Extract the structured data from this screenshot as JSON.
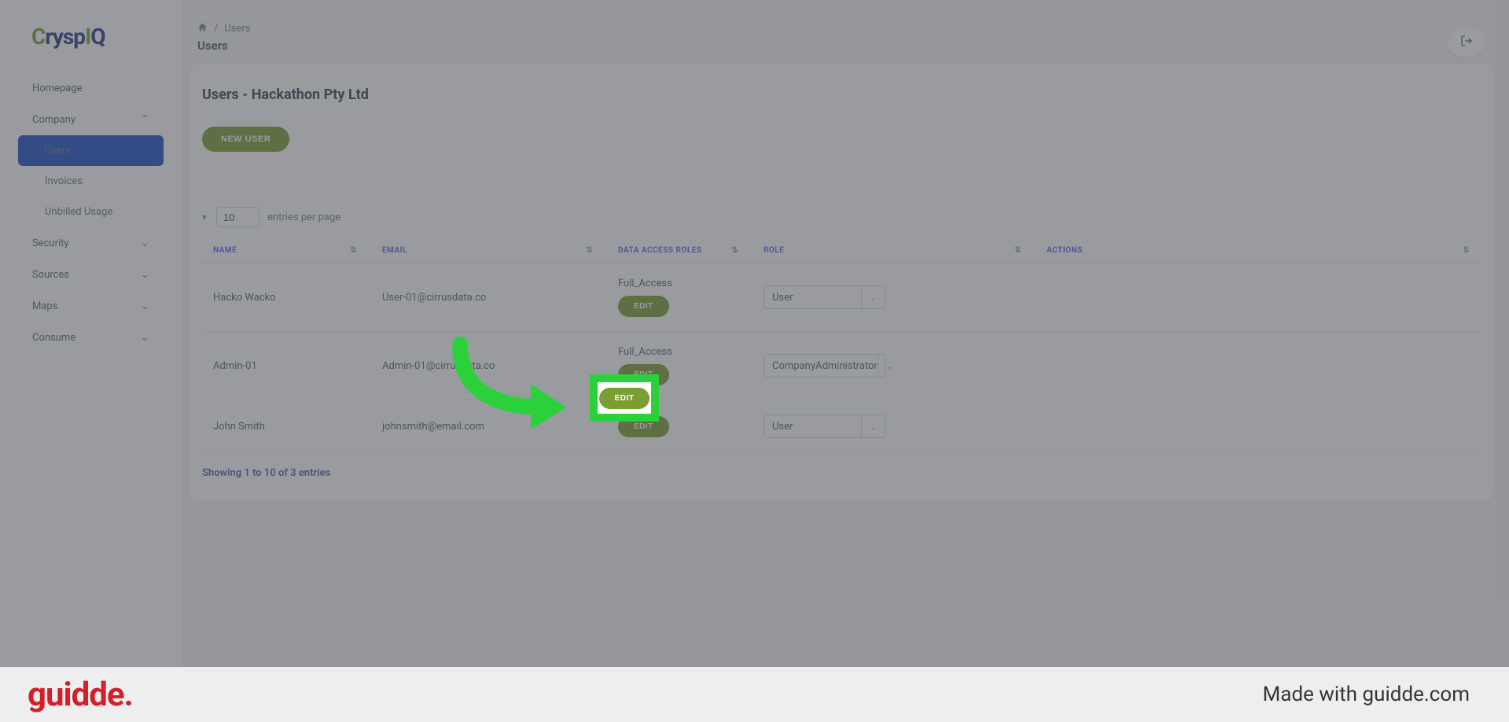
{
  "logo": {
    "c": "C",
    "rysp": "rysp",
    "i": "I",
    "q": "Q"
  },
  "breadcrumb": {
    "root": "Users"
  },
  "page": {
    "title": "Users"
  },
  "sidebar": {
    "items": [
      {
        "label": "Homepage"
      },
      {
        "label": "Company"
      },
      {
        "label": "Users"
      },
      {
        "label": "Invoices"
      },
      {
        "label": "Unbilled Usage"
      },
      {
        "label": "Security"
      },
      {
        "label": "Sources"
      },
      {
        "label": "Maps"
      },
      {
        "label": "Consume"
      }
    ]
  },
  "card": {
    "title": "Users - Hackathon Pty Ltd",
    "newUser": "NEW USER"
  },
  "entries": {
    "value": "10",
    "label": "entries per page"
  },
  "table": {
    "headers": {
      "name": "NAME",
      "email": "EMAIL",
      "roles": "DATA ACCESS ROLES",
      "role": "ROLE",
      "actions": "ACTIONS"
    },
    "rows": [
      {
        "name": "Hacko Wacko",
        "email": "User-01@cirrusdata.co",
        "access": "Full_Access",
        "edit": "EDIT",
        "role": "User"
      },
      {
        "name": "Admin-01",
        "email": "Admin-01@cirrusdata.co",
        "access": "Full_Access",
        "edit": "EDIT",
        "role": "CompanyAdministrator"
      },
      {
        "name": "John Smith",
        "email": "johnsmith@email.com",
        "access": "",
        "edit": "EDIT",
        "role": "User"
      }
    ]
  },
  "footer": {
    "info": "Showing 1 to 10 of 3 entries"
  },
  "highlight": {
    "label": "EDIT"
  },
  "banner": {
    "logo": "guidde.",
    "text": "Made with guidde.com"
  }
}
